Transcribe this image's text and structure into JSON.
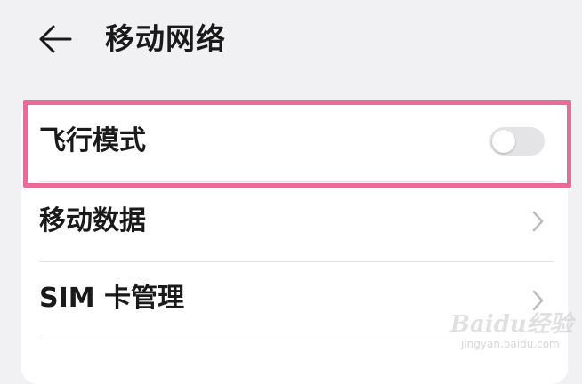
{
  "header": {
    "back_icon": "arrow-left-icon",
    "title": "移动网络"
  },
  "settings": {
    "airplane_mode": {
      "label": "飞行模式",
      "enabled": false,
      "highlight_color": "#e76c98"
    },
    "mobile_data": {
      "label": "移动数据",
      "icon": "chevron-right-icon"
    },
    "sim_management": {
      "label": "SIM 卡管理",
      "icon": "chevron-right-icon"
    }
  },
  "watermark": {
    "logo": "Baidu经验",
    "url": "jingyan.baidu.com"
  }
}
